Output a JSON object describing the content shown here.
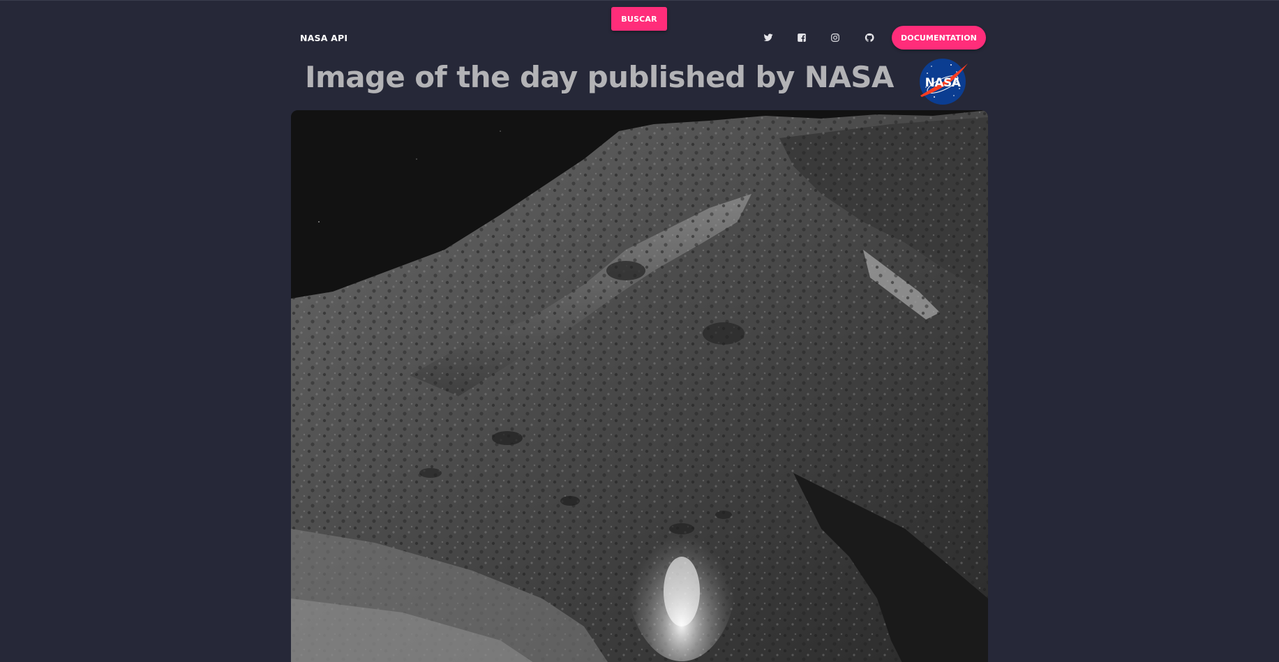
{
  "search_button": {
    "label": "BUSCAR"
  },
  "navbar": {
    "brand": "NASA API",
    "social_icons": [
      "twitter-icon",
      "facebook-icon",
      "instagram-icon",
      "github-icon"
    ],
    "documentation_label": "DOCUMENTATION"
  },
  "hero": {
    "title": "Image of the day published by NASA",
    "logo_text": "NASA"
  },
  "colors": {
    "background": "#262838",
    "accent": "#ff2d7a",
    "title": "#b3b3b6",
    "nasa_blue": "#0b3d91",
    "nasa_red": "#fc3d21"
  }
}
